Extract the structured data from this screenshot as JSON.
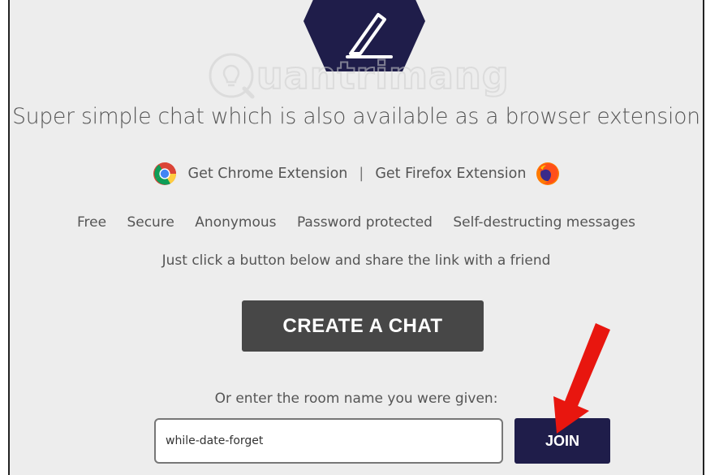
{
  "watermark": {
    "text": "uantrimang"
  },
  "tagline": "Super simple chat which is also available as a browser extension",
  "extensions": {
    "chrome_label": "Get Chrome Extension",
    "separator": "|",
    "firefox_label": "Get Firefox Extension"
  },
  "features": [
    "Free",
    "Secure",
    "Anonymous",
    "Password protected",
    "Self-destructing messages"
  ],
  "instruction": "Just click a button below and share the link with a friend",
  "create_button": "CREATE A CHAT",
  "room": {
    "label": "Or enter the room name you were given:",
    "value": "while-date-forget"
  },
  "join_button": "JOIN",
  "colors": {
    "background": "#ededed",
    "logo": "#1f1d4a",
    "create_button": "#474747",
    "join_button": "#1f1d4a",
    "arrow": "#e8160f"
  }
}
